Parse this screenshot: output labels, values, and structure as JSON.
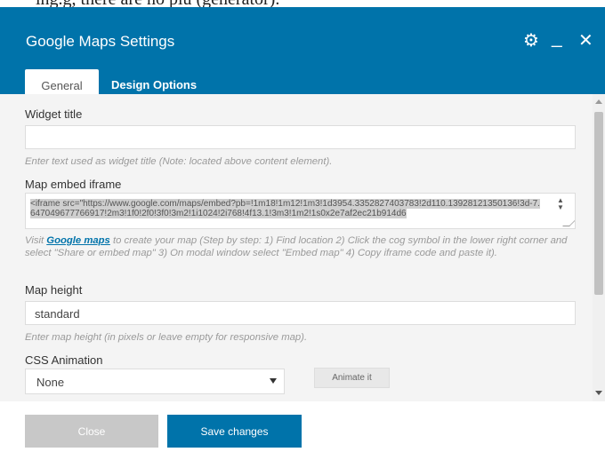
{
  "background_text": "ing.g, there are no plu (generator).",
  "header": {
    "title": "Google Maps Settings",
    "icons": [
      "gear-icon",
      "minimize-icon",
      "close-icon"
    ],
    "accent_color": "#0073aa"
  },
  "tabs": [
    {
      "label": "General",
      "active": true
    },
    {
      "label": "Design Options",
      "active": false
    }
  ],
  "fields": {
    "widget_title": {
      "label": "Widget title",
      "value": "",
      "description": "Enter text used as widget title (Note: located above content element)."
    },
    "map_embed": {
      "label": "Map embed iframe",
      "value": "<iframe src=\"https://www.google.com/maps/embed?pb=!1m18!1m12!1m3!1d3954.335282740378​3!2d110.13928121350136!3d-7.647049677766917!2m3!1f0!2f0!3f0!3m2!1i1024!2i768!4f13.1!3m3!1m2!1s0x2e7af2ec21b914d6",
      "description_pre": "Visit ",
      "description_link": "Google maps",
      "description_post": " to create your map (Step by step: 1) Find location 2) Click the cog symbol in the lower right corner and select \"Share or embed map\" 3) On modal window select \"Embed map\" 4) Copy iframe code and paste it)."
    },
    "map_height": {
      "label": "Map height",
      "value": "standard",
      "description": "Enter map height (in pixels or leave empty for responsive map)."
    },
    "css_animation": {
      "label": "CSS Animation",
      "selected": "None",
      "animate_label": "Animate it"
    }
  },
  "footer": {
    "close_label": "Close",
    "save_label": "Save changes"
  }
}
